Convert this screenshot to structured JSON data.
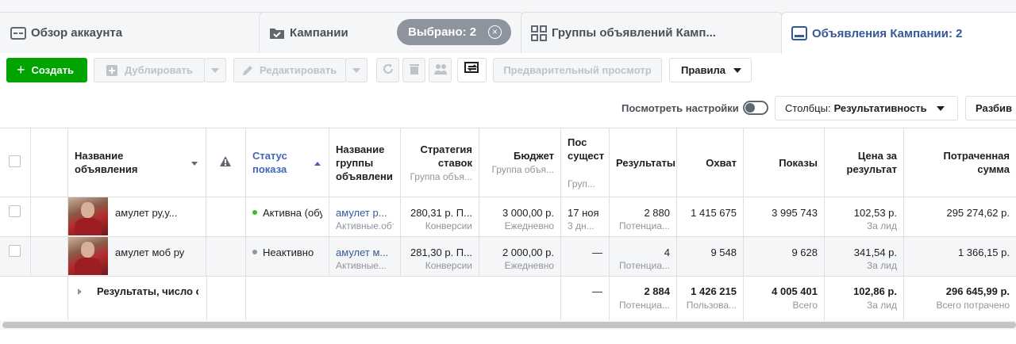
{
  "tabs": {
    "account": "Обзор аккаунта",
    "campaigns": "Кампании",
    "selected": "Выбрано: 2",
    "adsets": "Группы объявлений Камп...",
    "ads": "Объявления Кампании: 2"
  },
  "toolbar": {
    "create": "Создать",
    "duplicate": "Дублировать",
    "edit": "Редактировать",
    "preview": "Предварительный просмотр",
    "rules": "Правила",
    "view_settings": "Посмотреть настройки",
    "columns_prefix": "Столбцы:",
    "columns_value": "Результативность",
    "breakdown": "Разбив"
  },
  "columns": {
    "name": "Название\nобъявления",
    "status": "Статус\nпоказа",
    "adset": "Название\nгруппы\nобъявлени",
    "bid": "Стратегия\nставок",
    "bid_sub": "Группа объя...",
    "budget": "Бюджет",
    "budget_sub": "Группа объя...",
    "last_sig": "Пос\nсущест",
    "last_sig_sub": "Груп...",
    "results": "Результаты",
    "reach": "Охват",
    "impressions": "Показы",
    "cpr": "Цена за\nрезультат",
    "spent": "Потраченная\nсумма"
  },
  "rows": [
    {
      "name": "амулет ру,у...",
      "status": "Активна (обуч",
      "adset": "амулет р...",
      "adset_sub": "Активные.обт",
      "bid": "280,31 р. П...",
      "bid_sub": "Конверсии",
      "budget": "3 000,00 р.",
      "budget_sub": "Ежедневно",
      "last": "17 ноя",
      "last_sub": "3 дн...",
      "results": "2 880",
      "results_sub": "Потенциа...",
      "reach": "1 415 675",
      "impressions": "3 995 743",
      "cpr": "102,53 р.",
      "cpr_sub": "За лид",
      "spent": "295 274,62 р."
    },
    {
      "name": "амулет моб ру",
      "status": "Неактивно",
      "adset": "амулет м...",
      "adset_sub": "Активные...",
      "bid": "281,30 р. П...",
      "bid_sub": "Конверсии",
      "budget": "2 000,00 р.",
      "budget_sub": "Ежедневно",
      "last": "—",
      "results": "4",
      "results_sub": "Потенциа...",
      "reach": "9 548",
      "impressions": "9 628",
      "cpr": "341,54 р.",
      "cpr_sub": "За лид",
      "spent": "1 366,15 р."
    }
  ],
  "totals": {
    "label": "Результаты, число объявлений",
    "last": "—",
    "results": "2 884",
    "results_sub": "Потенциа...",
    "reach": "1 426 215",
    "reach_sub": "Пользова...",
    "impressions": "4 005 401",
    "impressions_sub": "Всего",
    "cpr": "102,86 р.",
    "cpr_sub": "За лид",
    "spent": "296 645,99 р.",
    "spent_sub": "Всего потрачено"
  },
  "colors": {
    "accent": "#4267b2",
    "create": "#00a400",
    "toggle_on": "#1877f2",
    "active_dot": "#42b72a"
  }
}
